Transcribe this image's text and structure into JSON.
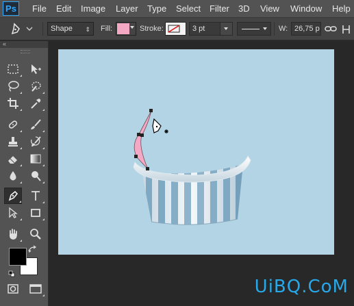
{
  "app": {
    "logo_text": "Ps"
  },
  "menu": {
    "items": [
      "File",
      "Edit",
      "Image",
      "Layer",
      "Type",
      "Select",
      "Filter",
      "3D",
      "View",
      "Window",
      "Help"
    ]
  },
  "options_bar": {
    "tool_mode": "Shape",
    "fill_label": "Fill:",
    "fill_color": "#f4a8c3",
    "stroke_label": "Stroke:",
    "stroke_size": "3 pt",
    "width_label": "W:",
    "width_value": "26,75 p"
  },
  "tools": {
    "fg_color": "#000000",
    "bg_color": "#ffffff"
  },
  "canvas": {
    "background": "#b2d4e5"
  },
  "watermark": "UiBQ.CoM"
}
